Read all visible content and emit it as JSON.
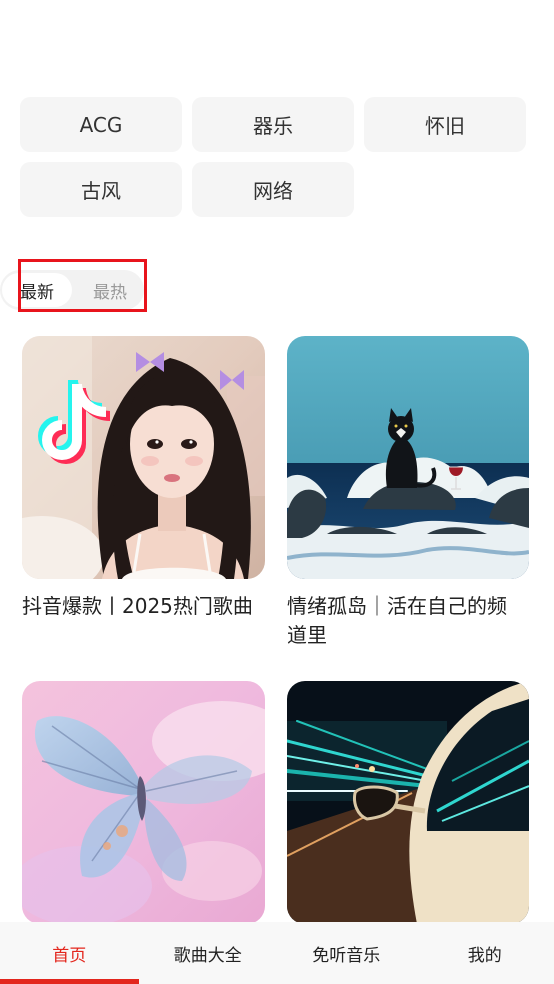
{
  "categories": [
    "ACG",
    "器乐",
    "怀旧",
    "古风",
    "网络"
  ],
  "sort_tabs": {
    "options": [
      "最新",
      "最热"
    ],
    "selected": "最新"
  },
  "playlists": [
    {
      "title": "抖音爆款丨2025热门歌曲"
    },
    {
      "title": "情绪孤岛｜活在自己的频道里"
    }
  ],
  "bottom_nav": {
    "tabs": [
      "首页",
      "歌曲大全",
      "免听音乐",
      "我的"
    ],
    "active": "首页"
  },
  "theme": {
    "accent": "#e3261d",
    "highlight": "#e8141c",
    "chip_bg": "#f5f5f5",
    "toggle_bg": "#f2f2f2",
    "text": "#222222",
    "muted": "#999999",
    "nav_bg": "#f8f8f8"
  }
}
